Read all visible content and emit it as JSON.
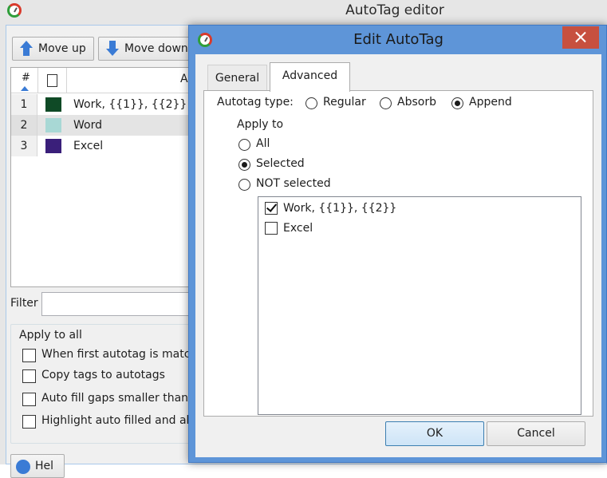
{
  "main_window": {
    "title": "AutoTag editor",
    "toolbar": {
      "move_up_label": "Move up",
      "move_down_label": "Move down"
    },
    "grid": {
      "columns": {
        "number": "#",
        "name_partial": "A"
      },
      "rows": [
        {
          "num": "1",
          "color": "#0f4a26",
          "name": "Work, {{1}}, {{2}}"
        },
        {
          "num": "2",
          "color": "#a8d8d5",
          "name": "Word"
        },
        {
          "num": "3",
          "color": "#3a1f7a",
          "name": "Excel"
        }
      ]
    },
    "filter": {
      "label": "Filter",
      "value": ""
    },
    "apply_to_all": {
      "label": "Apply to all",
      "options": [
        {
          "label": "When first autotag is matche",
          "checked": false
        },
        {
          "label": "Copy tags to autotags",
          "checked": false
        },
        {
          "label": "Auto fill gaps smaller than",
          "checked": false
        },
        {
          "label": "Highlight auto filled and abs",
          "checked": false
        }
      ]
    },
    "help_label": "Hel"
  },
  "dialog": {
    "title": "Edit AutoTag",
    "tabs": [
      {
        "label": "General",
        "active": false
      },
      {
        "label": "Advanced",
        "active": true
      }
    ],
    "autotag_type": {
      "label": "Autotag type:",
      "options": [
        "Regular",
        "Absorb",
        "Append"
      ],
      "selected": "Append"
    },
    "apply_to": {
      "label": "Apply to",
      "options": [
        "All",
        "Selected",
        "NOT selected"
      ],
      "selected": "Selected"
    },
    "names_list": [
      {
        "label": "Work, {{1}}, {{2}}",
        "checked": true
      },
      {
        "label": "Excel",
        "checked": false
      }
    ],
    "ok_label": "OK",
    "cancel_label": "Cancel"
  },
  "colors": {
    "dialog_frame": "#5e95d8",
    "close_button": "#c7503f",
    "selected_row": "#e4e4e4"
  }
}
